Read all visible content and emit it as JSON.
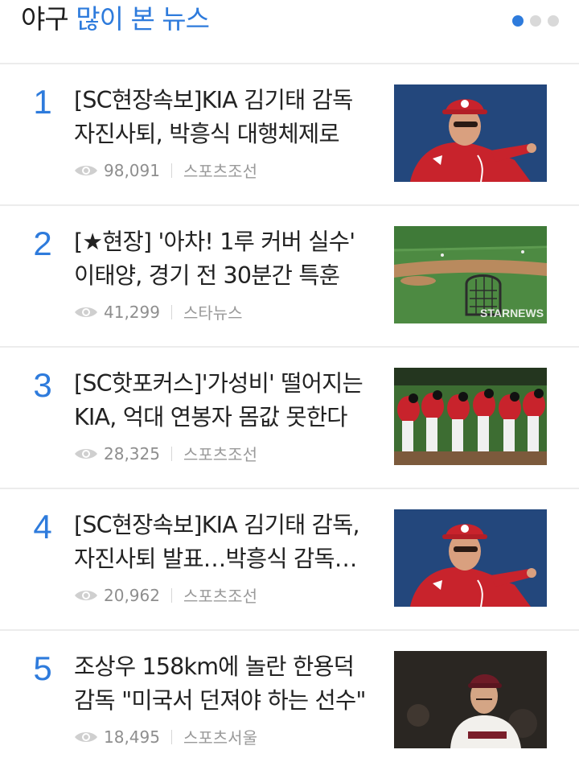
{
  "header": {
    "title_prefix": "야구",
    "title_main": "많이 본 뉴스",
    "pager_total": 3,
    "pager_active": 1
  },
  "colors": {
    "accent": "#2e7bdc",
    "text": "#222222",
    "meta": "#9a9a9a",
    "divider": "#ececec"
  },
  "articles": [
    {
      "rank": "1",
      "title": "[SC현장속보]KIA 김기태 감독 자진사퇴, 박흥식 대행체제로",
      "views": "98,091",
      "source": "스포츠조선",
      "image": "kia-manager-pointing"
    },
    {
      "rank": "2",
      "title": "[★현장] '아차! 1루 커버 실수' 이태양, 경기 전 30분간 특훈",
      "views": "41,299",
      "source": "스타뉴스",
      "image": "baseball-field-practice",
      "watermark": "STARNEWS"
    },
    {
      "rank": "3",
      "title": "[SC핫포커스]'가성비' 떨어지는 KIA, 억대 연봉자 몸값 못한다",
      "views": "28,325",
      "source": "스포츠조선",
      "image": "kia-players-bowing"
    },
    {
      "rank": "4",
      "title": "[SC현장속보]KIA 김기태 감독, 자진사퇴 발표…박흥식 감독대행",
      "views": "20,962",
      "source": "스포츠조선",
      "image": "kia-manager-pointing"
    },
    {
      "rank": "5",
      "title": "조상우 158km에 놀란 한용덕 감독 \"미국서 던져야 하는 선수\"",
      "views": "18,495",
      "source": "스포츠서울",
      "image": "kiwoom-pitcher"
    }
  ]
}
